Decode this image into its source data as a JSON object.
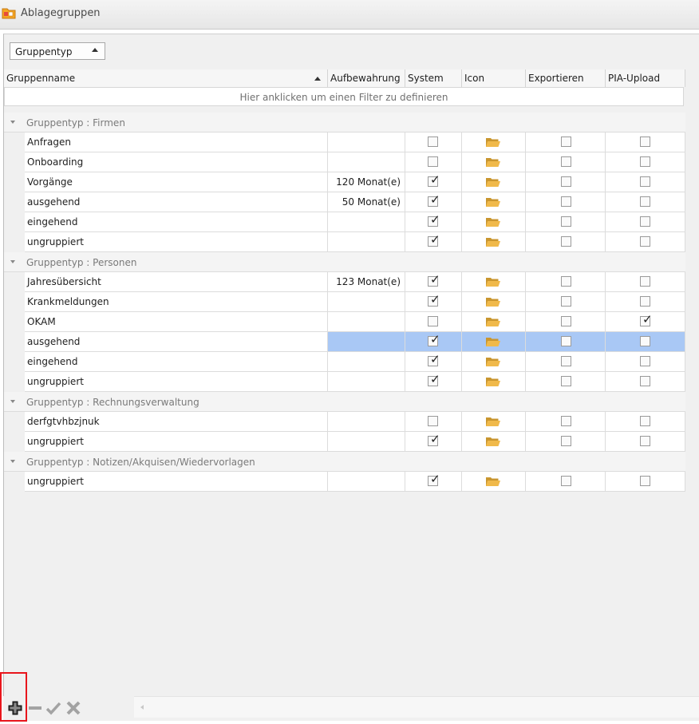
{
  "window": {
    "title": "Ablagegruppen",
    "icon": "folder-group-icon"
  },
  "grouppanel": {
    "chip_label": "Gruppentyp"
  },
  "columns": [
    "Gruppenname",
    "Aufbewahrung",
    "System",
    "Icon",
    "Exportieren",
    "PIA-Upload"
  ],
  "filter_text": "Hier anklicken um einen Filter zu definieren",
  "groups": [
    {
      "label": "Gruppentyp : Firmen",
      "rows": [
        {
          "name": "Anfragen",
          "aufb": "",
          "system": false,
          "export": false,
          "pia": false
        },
        {
          "name": "Onboarding",
          "aufb": "",
          "system": false,
          "export": false,
          "pia": false
        },
        {
          "name": "Vorgänge",
          "aufb": "120 Monat(e)",
          "system": true,
          "export": false,
          "pia": false
        },
        {
          "name": "ausgehend",
          "aufb": "50 Monat(e)",
          "system": true,
          "export": false,
          "pia": false
        },
        {
          "name": "eingehend",
          "aufb": "",
          "system": true,
          "export": false,
          "pia": false
        },
        {
          "name": "ungruppiert",
          "aufb": "",
          "system": true,
          "export": false,
          "pia": false
        }
      ]
    },
    {
      "label": "Gruppentyp : Personen",
      "rows": [
        {
          "name": "Jahresübersicht",
          "aufb": "123 Monat(e)",
          "system": true,
          "export": false,
          "pia": false
        },
        {
          "name": "Krankmeldungen",
          "aufb": "",
          "system": true,
          "export": false,
          "pia": false
        },
        {
          "name": "OKAM",
          "aufb": "",
          "system": false,
          "export": false,
          "pia": true
        },
        {
          "name": "ausgehend",
          "aufb": "",
          "system": true,
          "export": false,
          "pia": false,
          "selected": true
        },
        {
          "name": "eingehend",
          "aufb": "",
          "system": true,
          "export": false,
          "pia": false
        },
        {
          "name": "ungruppiert",
          "aufb": "",
          "system": true,
          "export": false,
          "pia": false
        }
      ]
    },
    {
      "label": "Gruppentyp : Rechnungsverwaltung",
      "rows": [
        {
          "name": "derfgtvhbzjnuk",
          "aufb": "",
          "system": false,
          "export": false,
          "pia": false
        },
        {
          "name": "ungruppiert",
          "aufb": "",
          "system": true,
          "export": false,
          "pia": false
        }
      ]
    },
    {
      "label": "Gruppentyp : Notizen/Akquisen/Wiedervorlagen",
      "rows": [
        {
          "name": "ungruppiert",
          "aufb": "",
          "system": true,
          "export": false,
          "pia": false
        }
      ]
    }
  ],
  "toolbar": {
    "buttons": [
      {
        "name": "add-button",
        "icon": "plus-icon",
        "highlighted": true
      },
      {
        "name": "remove-button",
        "icon": "minus-icon"
      },
      {
        "name": "confirm-button",
        "icon": "checkmark-icon"
      },
      {
        "name": "cancel-button",
        "icon": "x-icon"
      }
    ]
  },
  "colors": {
    "selection": "#a9c8f5",
    "highlight_box": "#e8151c",
    "folder": "#f0b94a"
  }
}
